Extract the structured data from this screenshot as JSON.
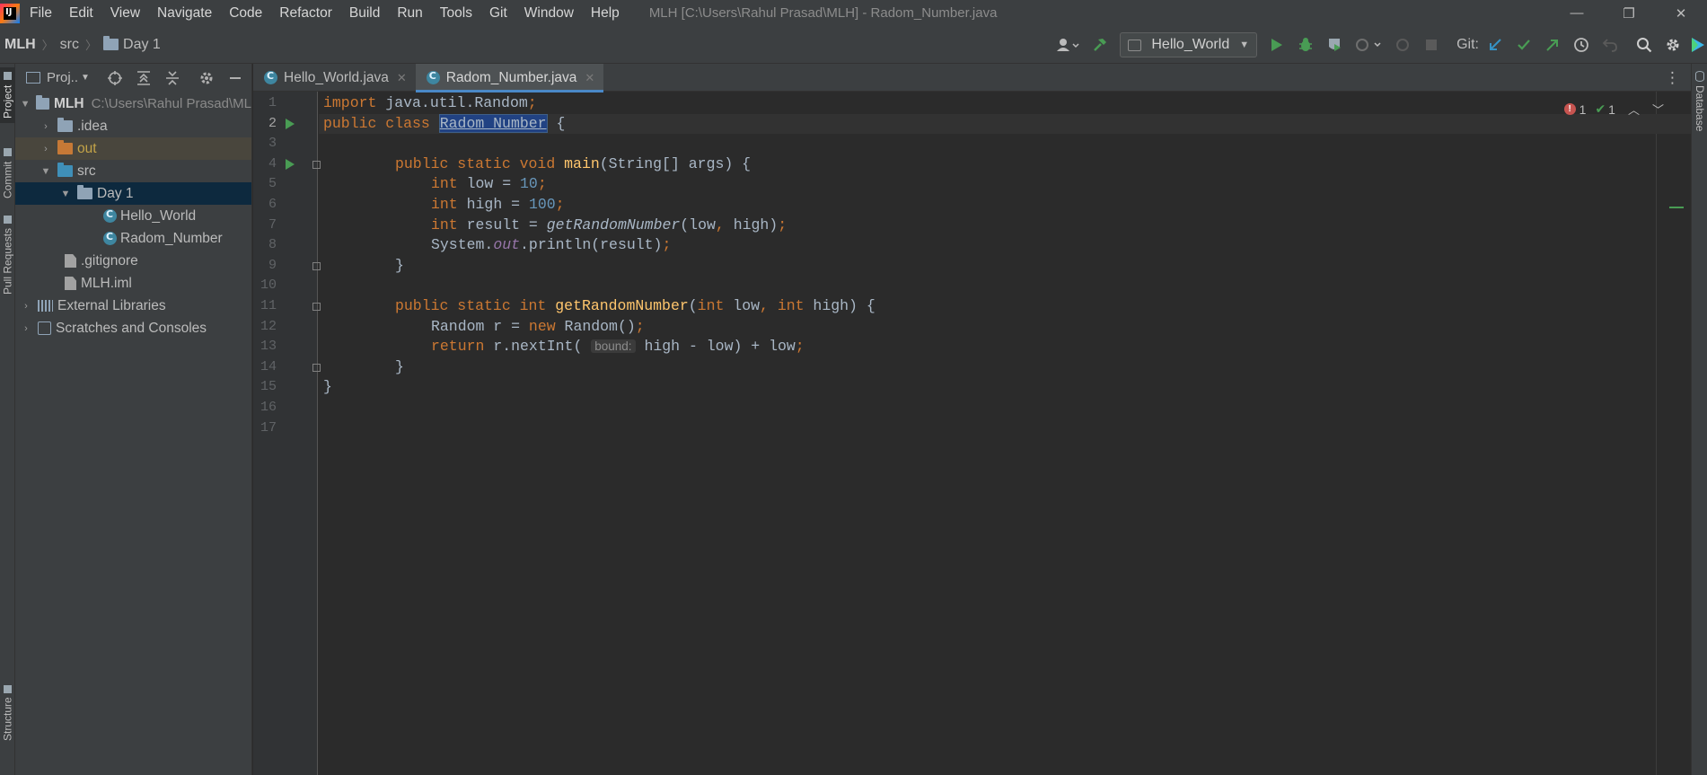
{
  "menubar": {
    "logo_text": "IJ",
    "items": [
      "File",
      "Edit",
      "View",
      "Navigate",
      "Code",
      "Refactor",
      "Build",
      "Run",
      "Tools",
      "Git",
      "Window",
      "Help"
    ],
    "window_title": "MLH [C:\\Users\\Rahul Prasad\\MLH] - Radom_Number.java",
    "controls": {
      "minimize": "—",
      "restore": "❐",
      "close": "✕"
    }
  },
  "navbar": {
    "breadcrumb": [
      "MLH",
      "src",
      "Day 1"
    ],
    "run_config": "Hello_World",
    "git_label": "Git:"
  },
  "left_stripe": {
    "project": "Project",
    "commit": "Commit",
    "pull_requests": "Pull Requests",
    "structure": "Structure"
  },
  "right_stripe": {
    "database": "Database"
  },
  "project_panel": {
    "title": "Proj..",
    "tree": [
      {
        "label": "MLH",
        "hint": "C:\\Users\\Rahul Prasad\\ML",
        "arrow": "expanded",
        "icon": "folder-grey",
        "depth": 0
      },
      {
        "label": ".idea",
        "hint": "",
        "arrow": "collapsed",
        "icon": "folder-grey",
        "depth": 1
      },
      {
        "label": "out",
        "hint": "",
        "arrow": "collapsed",
        "icon": "folder-orange",
        "depth": 1
      },
      {
        "label": "src",
        "hint": "",
        "arrow": "expanded",
        "icon": "folder-blue",
        "depth": 1
      },
      {
        "label": "Day 1",
        "hint": "",
        "arrow": "expanded",
        "icon": "folder-grey",
        "depth": 2
      },
      {
        "label": "Hello_World",
        "hint": "",
        "arrow": "none",
        "icon": "class",
        "depth": 3
      },
      {
        "label": "Radom_Number",
        "hint": "",
        "arrow": "none",
        "icon": "class",
        "depth": 3
      },
      {
        "label": ".gitignore",
        "hint": "",
        "arrow": "none",
        "icon": "file",
        "depth": 1
      },
      {
        "label": "MLH.iml",
        "hint": "",
        "arrow": "none",
        "icon": "file",
        "depth": 1
      },
      {
        "label": "External Libraries",
        "hint": "",
        "arrow": "collapsed",
        "icon": "library",
        "depth": 0
      },
      {
        "label": "Scratches and Consoles",
        "hint": "",
        "arrow": "collapsed",
        "icon": "scratch",
        "depth": 0
      }
    ]
  },
  "editor": {
    "tabs": [
      {
        "label": "Hello_World.java",
        "active": false
      },
      {
        "label": "Radom_Number.java",
        "active": true
      }
    ],
    "inspections": {
      "errors": "1",
      "ok": "1"
    },
    "hint_bound": "bound:",
    "lines": [
      "1",
      "2",
      "3",
      "4",
      "5",
      "6",
      "7",
      "8",
      "9",
      "10",
      "11",
      "12",
      "13",
      "14",
      "15",
      "16",
      "17"
    ],
    "code": {
      "l1_kw": "import",
      "l1_rest": " java.util.Random",
      "l2_kw": "public class",
      "l2_cls": "Radom_Number",
      "l2_rest": " {",
      "l4_kw": "public static void",
      "l4_fn": "main",
      "l4_rest": "(String[] args) {",
      "l5_type": "int",
      "l5_var": " low = ",
      "l5_val": "10",
      "l6_type": "int",
      "l6_var": " high = ",
      "l6_val": "100",
      "l7_type": "int",
      "l7_var": " result = ",
      "l7_call": "getRandomNumber",
      "l7_args": "(low",
      "l7_args2": " high)",
      "l8_a": "System.",
      "l8_field": "out",
      "l8_b": ".println(result)",
      "l9": "}",
      "l11_kw": "public static int",
      "l11_fn": "getRandomNumber",
      "l11_a": "(",
      "l11_t1": "int",
      "l11_p1": " low",
      "l11_t2": "int",
      "l11_p2": " high) {",
      "l12_a": "Random r = ",
      "l12_kw": "new",
      "l12_b": " Random()",
      "l13_kw": "return",
      "l13_a": " r.nextInt(",
      "l13_b": "high - low) + low",
      "l14": "}",
      "l15": "}"
    }
  }
}
